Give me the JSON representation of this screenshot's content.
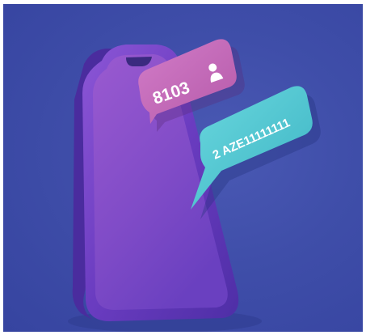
{
  "image": {
    "type": "illustration",
    "background_color": "#3f4ea9",
    "phone_color": "#6a3fc2",
    "phone_screen_color": "#8a4fc9"
  },
  "bubbles": {
    "pink": {
      "text": "8103",
      "icon": "person-icon",
      "color": "#c468b9"
    },
    "cyan": {
      "text": "2 AZE11111111",
      "color": "#4fc4d0"
    }
  }
}
